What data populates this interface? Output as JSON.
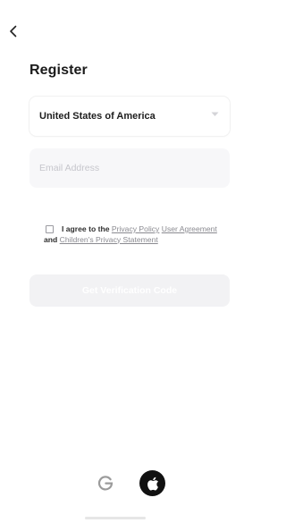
{
  "nav": {
    "back_icon": "chevron-left-icon"
  },
  "header": {
    "title": "Register"
  },
  "form": {
    "country": {
      "value": "United States of America",
      "icon": "chevron-down-icon"
    },
    "email": {
      "value": "",
      "placeholder": "Email Address"
    },
    "agreement": {
      "checked": false,
      "text_before": "I agree to the",
      "privacy_policy_link": "Privacy Policy",
      "user_agreement_link": "User Agreement",
      "conjunction": "and",
      "childrens_privacy_link": "Children's Privacy Statement"
    },
    "submit_label": "Get Verification Code"
  },
  "social_login": {
    "google_icon": "google-icon",
    "apple_icon": "apple-icon"
  },
  "colors": {
    "title": "#1b1b1b",
    "input_background": "#f7f7f9",
    "placeholder": "#c6c6cc",
    "link": "#8a8a90",
    "disabled_button": "#f2f2f4",
    "apple_button": "#111111"
  }
}
